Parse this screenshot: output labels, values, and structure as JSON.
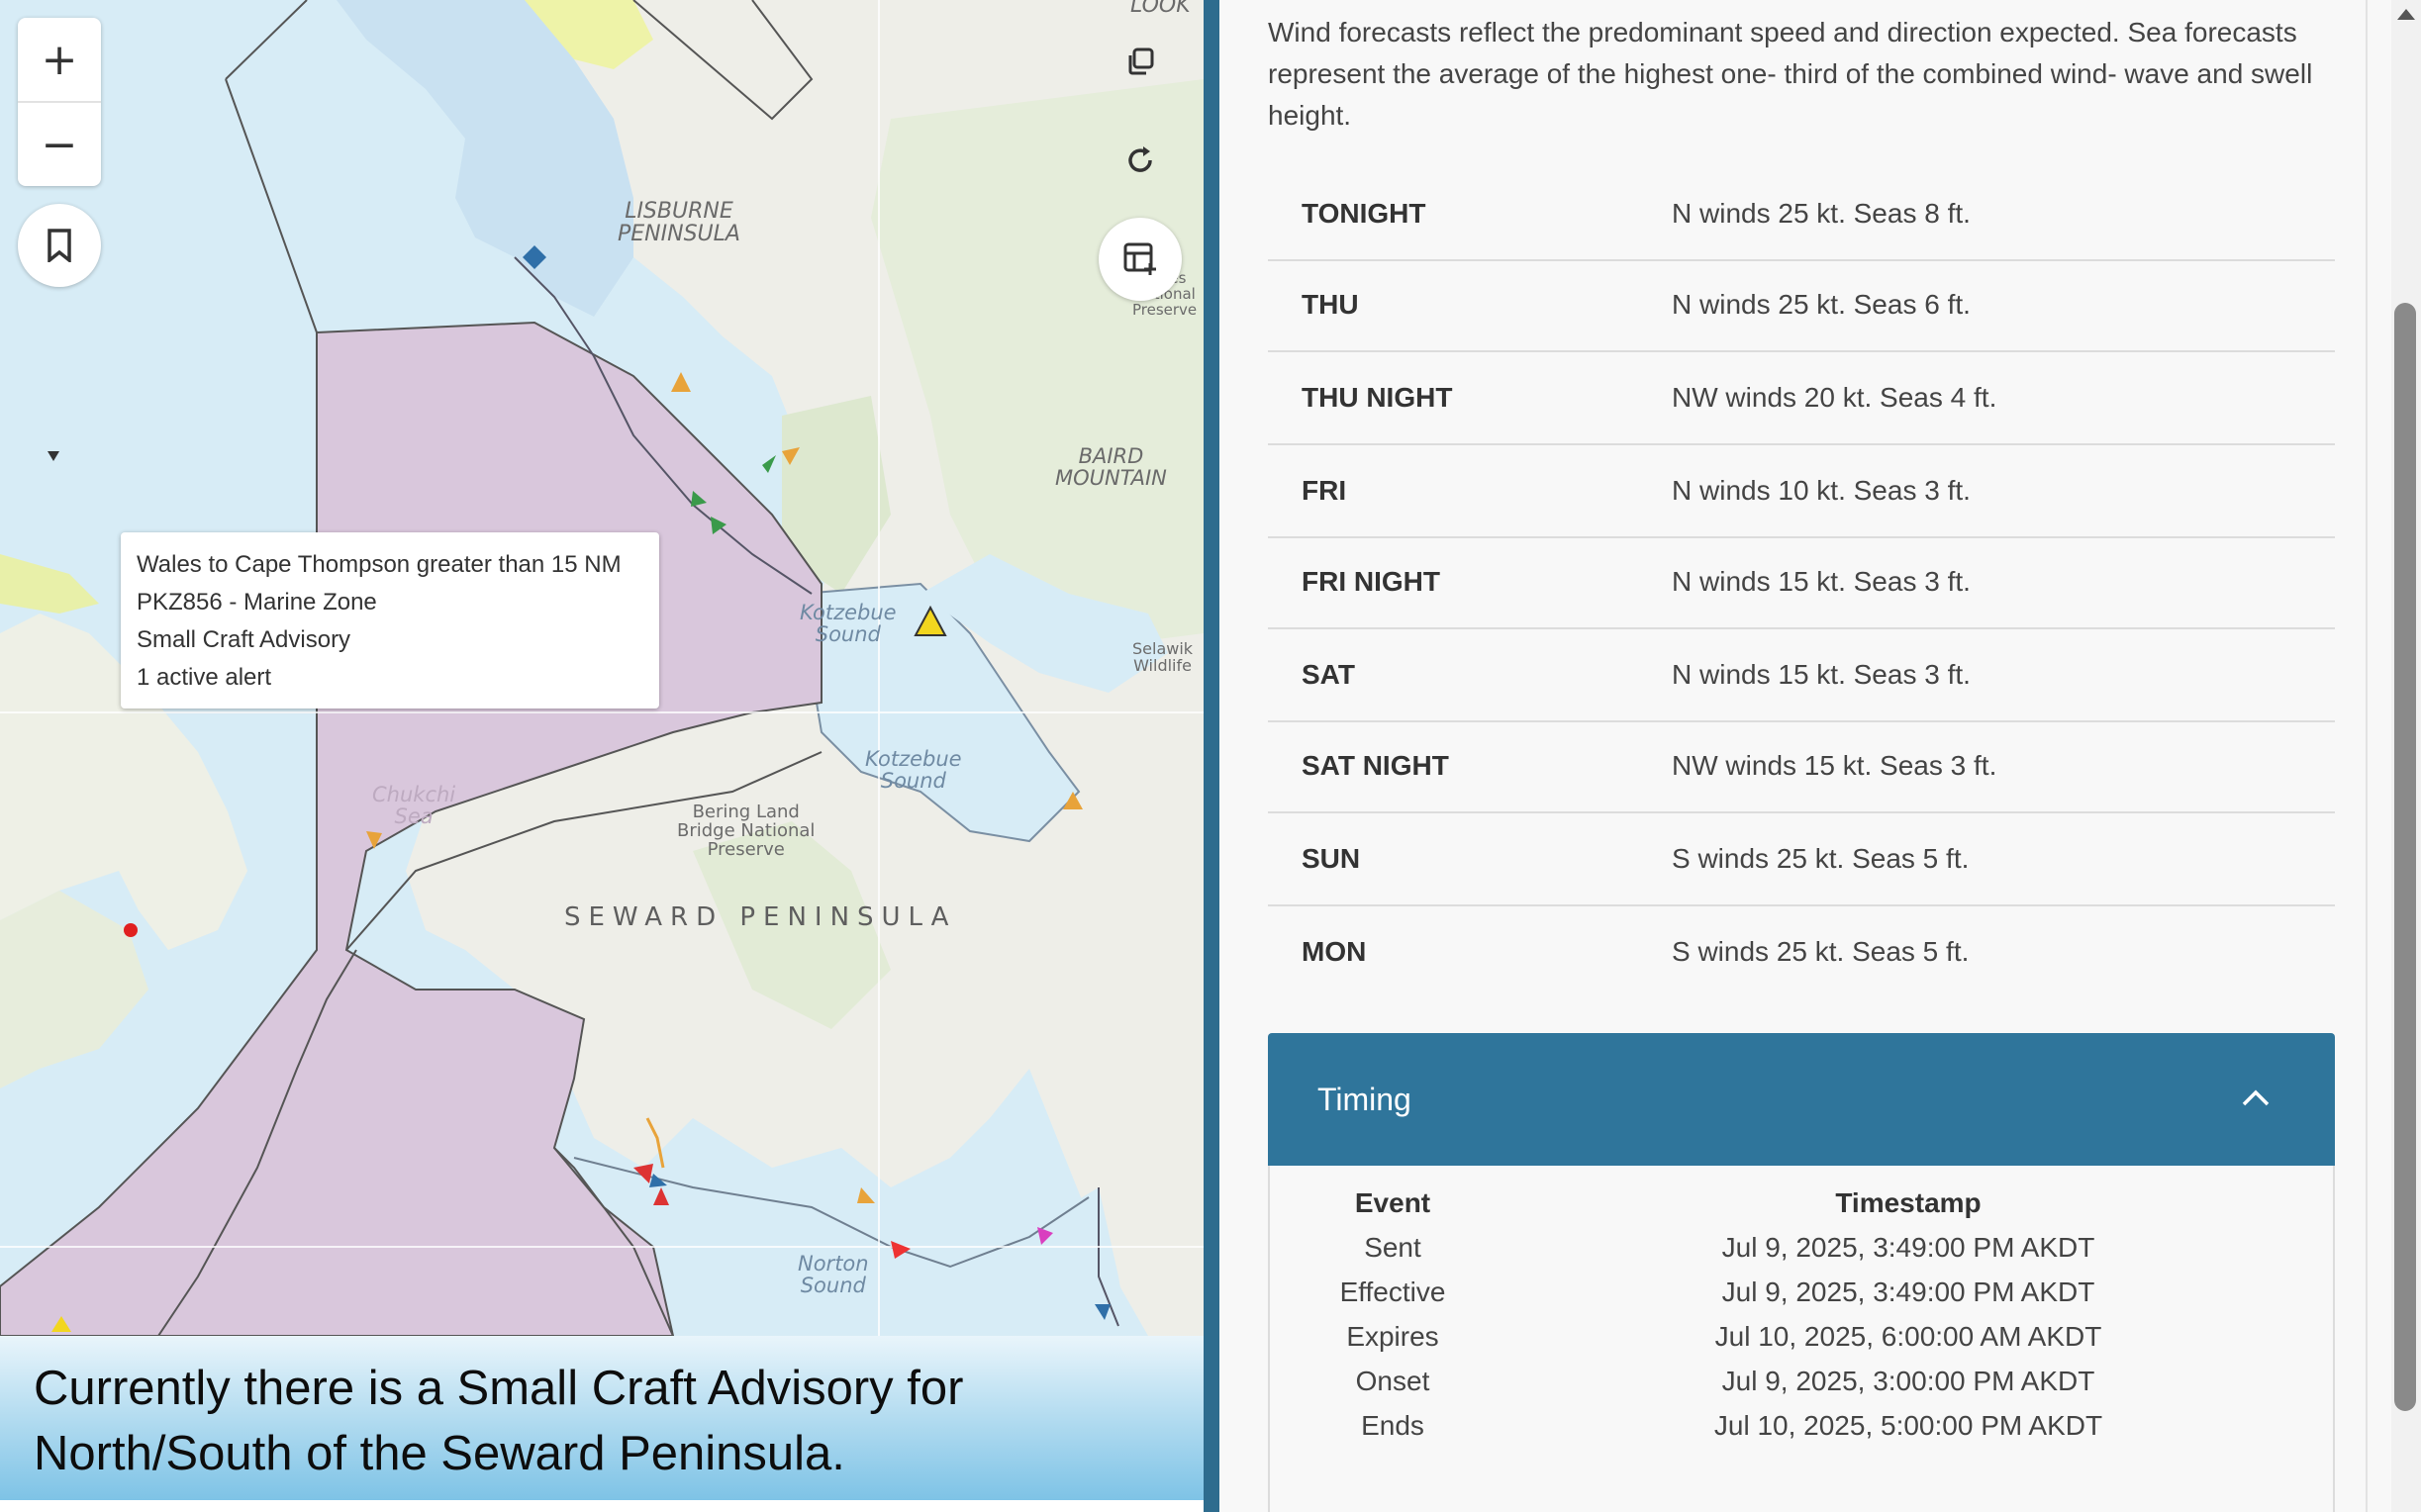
{
  "map": {
    "zoom_in": "+",
    "zoom_out": "−",
    "labels": {
      "lisburne": "LISBURNE\nPENINSULA",
      "baird": "BAIRD\nMOUNTAIN",
      "kotzebue_sound_1": "Kotzebue\nSound",
      "kotzebue_sound_2": "Kotzebue\nSound",
      "bering_land": "Bering Land\nBridge National\nPreserve",
      "chukchi": "Chukchi\nSea",
      "seward": "SEWARD PENINSULA",
      "norton": "Norton\nSound",
      "look": "LOOK",
      "selawik": "Selawik\nWildlife",
      "preserve": "Gates\nNational\nPreserve"
    },
    "popup": {
      "line1": "Wales to Cape Thompson greater than 15 NM",
      "line2": "PKZ856 - Marine Zone",
      "line3": "Small Craft Advisory",
      "line4": "1 active alert"
    }
  },
  "caption": {
    "line1": "Currently there is a Small Craft Advisory for",
    "line2": "North/South of the Seward Peninsula."
  },
  "panel": {
    "intro": "Wind forecasts reflect the predominant speed and direction expected. Sea forecasts represent the average of the highest one- third of the combined wind- wave and swell height.",
    "forecast": [
      {
        "period": "TONIGHT",
        "text": "N winds 25 kt. Seas 8 ft."
      },
      {
        "period": "THU",
        "text": "N winds 25 kt. Seas 6 ft."
      },
      {
        "period": "THU NIGHT",
        "text": "NW winds 20 kt. Seas 4 ft."
      },
      {
        "period": "FRI",
        "text": "N winds 10 kt. Seas 3 ft."
      },
      {
        "period": "FRI NIGHT",
        "text": "N winds 15 kt. Seas 3 ft."
      },
      {
        "period": "SAT",
        "text": "N winds 15 kt. Seas 3 ft."
      },
      {
        "period": "SAT NIGHT",
        "text": "NW winds 15 kt. Seas 3 ft."
      },
      {
        "period": "SUN",
        "text": "S winds 25 kt. Seas 5 ft."
      },
      {
        "period": "MON",
        "text": "S winds 25 kt. Seas 5 ft."
      }
    ],
    "timing": {
      "title": "Timing",
      "col_event": "Event",
      "col_timestamp": "Timestamp",
      "rows": [
        {
          "event": "Sent",
          "timestamp": "Jul 9, 2025, 3:49:00 PM AKDT"
        },
        {
          "event": "Effective",
          "timestamp": "Jul 9, 2025, 3:49:00 PM AKDT"
        },
        {
          "event": "Expires",
          "timestamp": "Jul 10, 2025, 6:00:00 AM AKDT"
        },
        {
          "event": "Onset",
          "timestamp": "Jul 9, 2025, 3:00:00 PM AKDT"
        },
        {
          "event": "Ends",
          "timestamp": "Jul 10, 2025, 5:00:00 PM AKDT"
        }
      ]
    }
  },
  "colors": {
    "ocean": "#d7ecf6",
    "land": "#eeeeea",
    "marine_zone": "#d9c7dc",
    "accent": "#2f759b",
    "divider": "#2e6c8e"
  }
}
